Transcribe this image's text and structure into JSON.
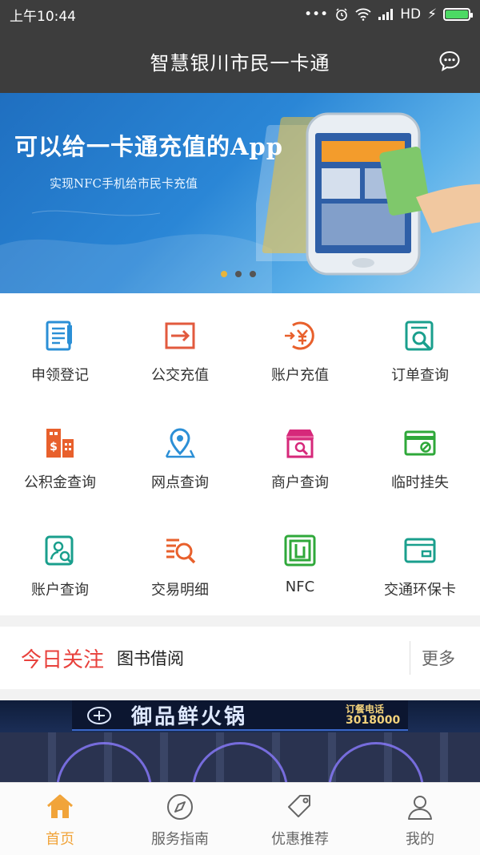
{
  "status": {
    "time": "上午10:44",
    "network": "HD"
  },
  "header": {
    "title": "智慧银川市民一卡通",
    "message_icon": "chat-bubble-icon"
  },
  "banner": {
    "title": "可以给一卡通充值的App",
    "subtitle": "实现NFC手机给市民卡充值",
    "pages": 3,
    "active_page": 1
  },
  "services": [
    {
      "label": "申领登记",
      "icon": "form-document-icon",
      "color": "#2b8fd6"
    },
    {
      "label": "公交充值",
      "icon": "transfer-arrow-icon",
      "color": "#e25a3e"
    },
    {
      "label": "账户充值",
      "icon": "yuan-recharge-icon",
      "color": "#e8602c"
    },
    {
      "label": "订单查询",
      "icon": "order-search-icon",
      "color": "#1a9f8d"
    },
    {
      "label": "公积金查询",
      "icon": "buildings-fund-icon",
      "color": "#e8602c"
    },
    {
      "label": "网点查询",
      "icon": "location-pin-icon",
      "color": "#2b8fd6"
    },
    {
      "label": "商户查询",
      "icon": "shop-icon",
      "color": "#d6287a"
    },
    {
      "label": "临时挂失",
      "icon": "card-block-icon",
      "color": "#2fa83a"
    },
    {
      "label": "账户查询",
      "icon": "user-search-icon",
      "color": "#1a9f8d"
    },
    {
      "label": "交易明细",
      "icon": "list-search-icon",
      "color": "#e8602c"
    },
    {
      "label": "NFC",
      "icon": "nfc-icon",
      "color": "#2fa83a"
    },
    {
      "label": "交通环保卡",
      "icon": "transit-card-icon",
      "color": "#1a9f8d"
    }
  ],
  "focus": {
    "title": "今日关注",
    "subtitle": "图书借阅",
    "more": "更多"
  },
  "promo": {
    "sign_text": "御品鲜火锅",
    "phone_label": "订餐电话",
    "phone_number": "3018000"
  },
  "bottom_nav": [
    {
      "label": "首页",
      "icon": "home-icon",
      "active": true
    },
    {
      "label": "服务指南",
      "icon": "compass-icon",
      "active": false
    },
    {
      "label": "优惠推荐",
      "icon": "price-tag-icon",
      "active": false
    },
    {
      "label": "我的",
      "icon": "person-icon",
      "active": false
    }
  ],
  "colors": {
    "active": "#f1a43a",
    "focus_title": "#e8413c",
    "bar": "#3d3d3d"
  }
}
